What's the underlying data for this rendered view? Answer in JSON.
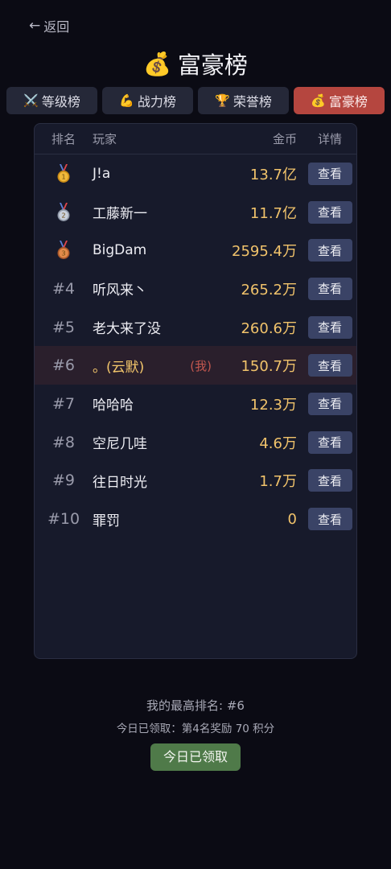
{
  "nav": {
    "back_label": "返回"
  },
  "title": {
    "icon": "💰",
    "text": "富豪榜"
  },
  "tabs": [
    {
      "icon": "⚔️",
      "label": "等级榜",
      "active": false
    },
    {
      "icon": "💪",
      "label": "战力榜",
      "active": false
    },
    {
      "icon": "🏆",
      "label": "荣誉榜",
      "active": false
    },
    {
      "icon": "💰",
      "label": "富豪榜",
      "active": true
    }
  ],
  "board": {
    "headers": {
      "rank": "排名",
      "player": "玩家",
      "gold": "金币",
      "detail": "详情"
    },
    "view_label": "查看",
    "me_tag": "(我)",
    "rows": [
      {
        "rank": "",
        "medal": "gold",
        "name": "J!a",
        "gold": "13.7亿",
        "me": false
      },
      {
        "rank": "",
        "medal": "silver",
        "name": "工藤新一",
        "gold": "11.7亿",
        "me": false
      },
      {
        "rank": "",
        "medal": "bronze",
        "name": "BigDam",
        "gold": "2595.4万",
        "me": false
      },
      {
        "rank": "#4",
        "medal": "",
        "name": "听风来丶",
        "gold": "265.2万",
        "me": false
      },
      {
        "rank": "#5",
        "medal": "",
        "name": "老大来了没",
        "gold": "260.6万",
        "me": false
      },
      {
        "rank": "#6",
        "medal": "",
        "name": "。(云默)",
        "gold": "150.7万",
        "me": true
      },
      {
        "rank": "#7",
        "medal": "",
        "name": "哈哈哈",
        "gold": "12.3万",
        "me": false
      },
      {
        "rank": "#8",
        "medal": "",
        "name": "空尼几哇",
        "gold": "4.6万",
        "me": false
      },
      {
        "rank": "#9",
        "medal": "",
        "name": "往日时光",
        "gold": "1.7万",
        "me": false
      },
      {
        "rank": "#10",
        "medal": "",
        "name": "罪罚",
        "gold": "0",
        "me": false
      }
    ]
  },
  "footer": {
    "best_rank": "我的最高排名: #6",
    "claimed_text": "今日已领取：第4名奖励 70 积分",
    "claim_button": "今日已领取"
  },
  "colors": {
    "background": "#0b0b14",
    "panel": "#171a2b",
    "gold_text": "#f1c36b",
    "active_tab": "#b5463f",
    "view_button": "#3a4366",
    "claim_button": "#4f7a49",
    "my_row": "#2a1f2c"
  }
}
